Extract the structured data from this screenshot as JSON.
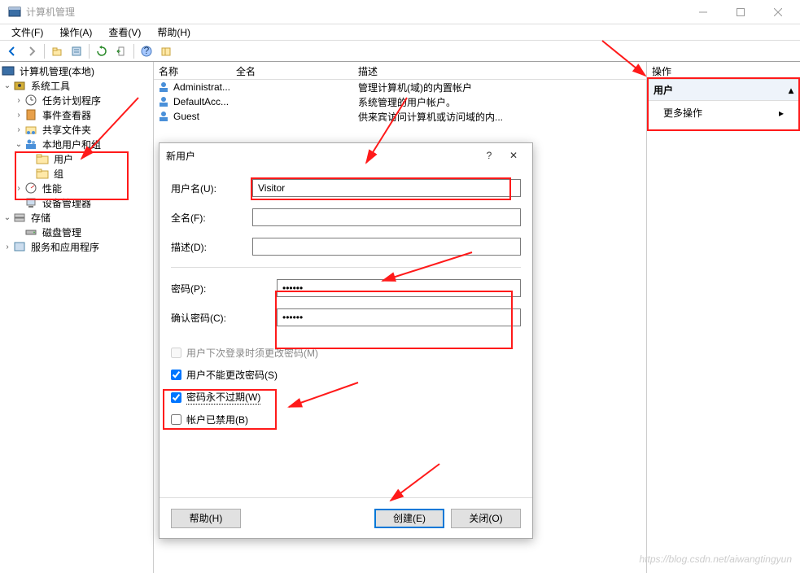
{
  "window": {
    "title": "计算机管理",
    "controls": {
      "minimize": "—",
      "maximize": "▢",
      "close": "✕"
    }
  },
  "menu": {
    "file": "文件(F)",
    "action": "操作(A)",
    "view": "查看(V)",
    "help": "帮助(H)"
  },
  "tree": {
    "root": "计算机管理(本地)",
    "system_tools": "系统工具",
    "task_scheduler": "任务计划程序",
    "event_viewer": "事件查看器",
    "shared_folders": "共享文件夹",
    "local_users_groups": "本地用户和组",
    "users": "用户",
    "groups": "组",
    "performance": "性能",
    "device_manager": "设备管理器",
    "storage": "存储",
    "disk_mgmt": "磁盘管理",
    "services_apps": "服务和应用程序"
  },
  "list": {
    "cols": {
      "name": "名称",
      "fullname": "全名",
      "desc": "描述"
    },
    "rows": [
      {
        "name": "Administrat...",
        "desc": "管理计算机(域)的内置帐户"
      },
      {
        "name": "DefaultAcc...",
        "desc": "系统管理的用户帐户。"
      },
      {
        "name": "Guest",
        "desc": "供来宾访问计算机或访问域的内..."
      }
    ]
  },
  "actions": {
    "header": "操作",
    "group": "用户",
    "more": "更多操作"
  },
  "dialog": {
    "title": "新用户",
    "help": "?",
    "labels": {
      "username": "用户名(U):",
      "fullname": "全名(F):",
      "description": "描述(D):",
      "password": "密码(P):",
      "confirm": "确认密码(C):"
    },
    "values": {
      "username": "Visitor",
      "password": "••••••",
      "confirm": "••••••"
    },
    "checks": {
      "must_change": "用户下次登录时须更改密码(M)",
      "cannot_change": "用户不能更改密码(S)",
      "never_expire": "密码永不过期(W)",
      "disabled": "帐户已禁用(B)"
    },
    "buttons": {
      "help": "帮助(H)",
      "create": "创建(E)",
      "close": "关闭(O)"
    }
  },
  "watermark": "https://blog.csdn.net/aiwangtingyun"
}
